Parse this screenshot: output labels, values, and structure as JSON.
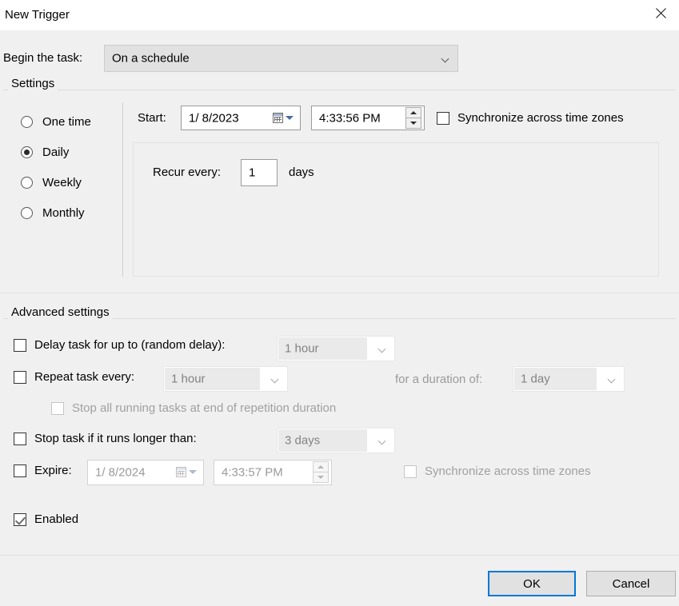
{
  "window": {
    "title": "New Trigger",
    "close_icon": "close-icon",
    "accent_color": "#0078d7"
  },
  "begin_task": {
    "label": "Begin the task:",
    "value": "On a schedule",
    "chevron_icon": "chevron-down-icon"
  },
  "settings": {
    "group_title": "Settings",
    "schedule_options": [
      {
        "label": "One time",
        "selected": false
      },
      {
        "label": "Daily",
        "selected": true
      },
      {
        "label": "Weekly",
        "selected": false
      },
      {
        "label": "Monthly",
        "selected": false
      }
    ],
    "start": {
      "label": "Start:",
      "date": "1/ 8/2023",
      "time": "4:33:56 PM",
      "calendar_icon": "calendar-icon",
      "spinner_icon": "spinner-updown-icon"
    },
    "sync_time_zones": {
      "label": "Synchronize across time zones",
      "checked": false,
      "enabled": true
    },
    "recur": {
      "label": "Recur every:",
      "value": "1",
      "unit": "days"
    }
  },
  "advanced": {
    "group_title": "Advanced settings",
    "delay_task": {
      "label": "Delay task for up to (random delay):",
      "checked": false,
      "value": "1 hour",
      "enabled": false
    },
    "repeat_task": {
      "label": "Repeat task every:",
      "checked": false,
      "value": "1 hour",
      "enabled": false,
      "duration_label": "for a duration of:",
      "duration_value": "1 day"
    },
    "stop_all_running": {
      "label": "Stop all running tasks at end of repetition duration",
      "checked": false,
      "enabled": false
    },
    "stop_if_longer": {
      "label": "Stop task if it runs longer than:",
      "checked": false,
      "value": "3 days",
      "enabled": false
    },
    "expire": {
      "label": "Expire:",
      "checked": false,
      "date": "1/ 8/2024",
      "time": "4:33:57 PM",
      "enabled": false,
      "sync_label": "Synchronize across time zones",
      "sync_checked": false
    },
    "enabled_option": {
      "label": "Enabled",
      "checked": true
    }
  },
  "footer": {
    "ok_label": "OK",
    "cancel_label": "Cancel"
  }
}
